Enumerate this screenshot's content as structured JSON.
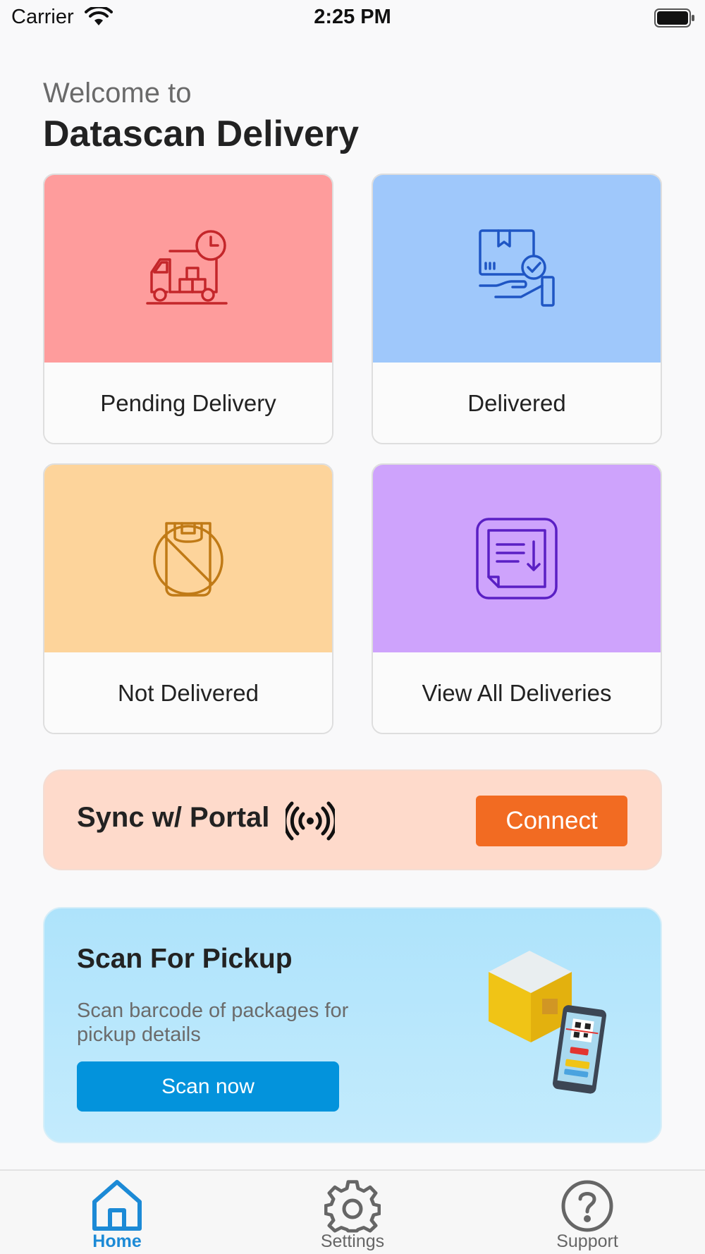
{
  "status_bar": {
    "carrier": "Carrier",
    "time": "2:25 PM"
  },
  "header": {
    "welcome": "Welcome to",
    "title": "Datascan Delivery"
  },
  "tiles": [
    {
      "label": "Pending Delivery",
      "color": "#fe9c9c",
      "icon": "delivery-truck-clock-icon"
    },
    {
      "label": "Delivered",
      "color": "#9fc8fb",
      "icon": "package-hand-check-icon"
    },
    {
      "label": "Not Delivered",
      "color": "#fdd49b",
      "icon": "bag-cancel-icon"
    },
    {
      "label": "View All Deliveries",
      "color": "#cea3fc",
      "icon": "list-download-icon"
    }
  ],
  "sync": {
    "label": "Sync w/ Portal",
    "icon": "broadcast-signal-icon",
    "button": "Connect",
    "color": "#f26b22"
  },
  "scan": {
    "title": "Scan For Pickup",
    "description": "Scan barcode of packages for pickup details",
    "button": "Scan now",
    "color": "#0393dc"
  },
  "tab_bar": {
    "tabs": [
      {
        "label": "Home",
        "icon": "home-icon",
        "active": true
      },
      {
        "label": "Settings",
        "icon": "gear-icon",
        "active": false
      },
      {
        "label": "Support",
        "icon": "question-circle-icon",
        "active": false
      }
    ],
    "active_color": "#1c8ad6"
  }
}
